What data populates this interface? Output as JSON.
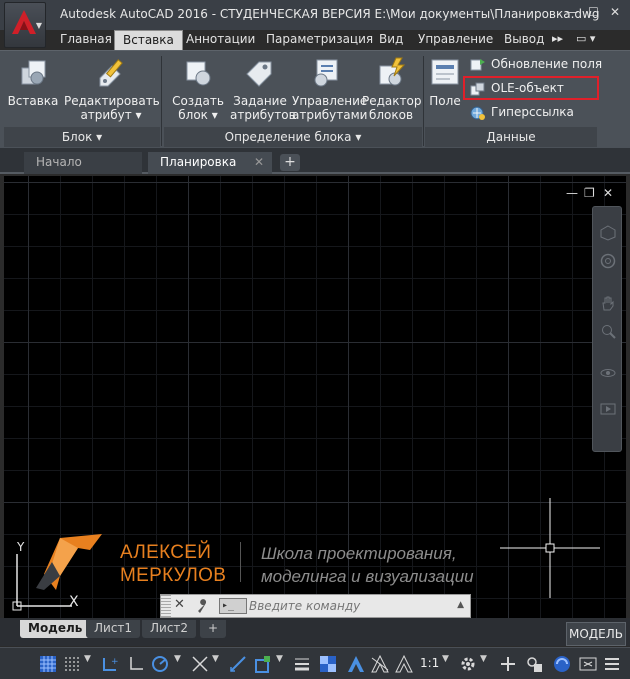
{
  "window": {
    "title": "Autodesk AutoCAD 2016 - СТУДЕНЧЕСКАЯ ВЕРСИЯ    E:\\Мои документы\\Планировка.dwg",
    "controls": {
      "minimize": "—",
      "maximize": "☐",
      "close": "✕"
    }
  },
  "ribbon_tabs": [
    "Главная",
    "Вставка",
    "Аннотации",
    "Параметризация",
    "Вид",
    "Управление",
    "Вывод"
  ],
  "ribbon_tab_active": "Вставка",
  "ribbon_tab_more": "▸▸",
  "ribbon_tab_toggle": "▭ ▾",
  "ribbon": {
    "block_panel": {
      "title": "Блок ▾",
      "commands": [
        {
          "label1": "Вставка",
          "label2": "",
          "icon": "insert-block-icon"
        },
        {
          "label1": "Редактировать",
          "label2": "атрибут ▾",
          "icon": "edit-attribute-icon"
        }
      ]
    },
    "block_def_panel": {
      "title": "Определение блока ▾",
      "commands": [
        {
          "label1": "Создать",
          "label2": "блок ▾",
          "icon": "create-block-icon"
        },
        {
          "label1": "Задание",
          "label2": "атрибутов",
          "icon": "define-attributes-icon"
        },
        {
          "label1": "Управление",
          "label2": "атрибутами",
          "icon": "manage-attributes-icon"
        },
        {
          "label1": "Редактор",
          "label2": "блоков",
          "icon": "block-editor-icon"
        }
      ]
    },
    "data_panel": {
      "title": "Данные",
      "field_label": "Поле",
      "update_fields": "Обновление поля",
      "ole_object": "OLE-объект",
      "hyperlink": "Гиперссылка"
    }
  },
  "doc_tabs": [
    {
      "label": "Начало",
      "active": false
    },
    {
      "label": "Планировка",
      "active": true,
      "close": "✕"
    }
  ],
  "doc_tab_add": "+",
  "viewport": {
    "minimize": "—",
    "restore": "❐",
    "close": "✕"
  },
  "ucs": {
    "x": "X",
    "y": "Y"
  },
  "brand": {
    "name_line1": "АЛЕКСЕЙ",
    "name_line2": "МЕРКУЛОВ",
    "tagline_line1": "Школа проектирования,",
    "tagline_line2": "моделинга и визуализации",
    "accent_color": "#e8801f"
  },
  "command_line": {
    "close": "✕",
    "prompt_label": "▸_",
    "placeholder": "Введите команду",
    "history_arrow": "▲"
  },
  "layout_tabs": [
    "Модель",
    "Лист1",
    "Лист2"
  ],
  "layout_tab_active": "Модель",
  "layout_tab_add": "+",
  "model_space_label": "МОДЕЛЬ",
  "status_bar": {
    "annotation_scale": "1:1",
    "icons": [
      "grid-icon",
      "snap-icon",
      "infer-constraints-icon",
      "ortho-icon",
      "polar-icon",
      "isodraft-icon",
      "object-snap-tracking-icon",
      "object-snap-icon",
      "lineweight-icon",
      "transparency-icon",
      "selection-cycling-icon",
      "annotation-visibility-icon",
      "auto-scale-icon",
      "annotation-scale-icon",
      "workspace-gear-icon",
      "add-icon",
      "isolate-objects-icon",
      "hardware-acceleration-icon",
      "clean-screen-icon",
      "customization-menu-icon"
    ]
  }
}
